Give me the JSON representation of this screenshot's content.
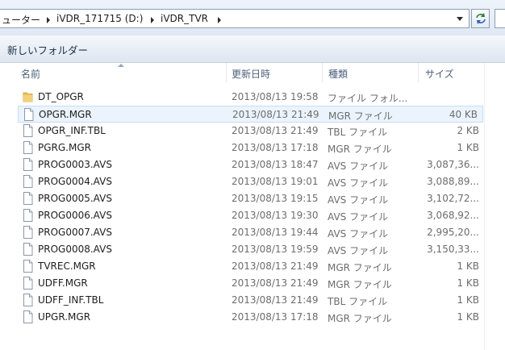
{
  "address_bar": {
    "crumbs": [
      {
        "label": "ューター"
      },
      {
        "label": "iVDR_171715 (D:)"
      },
      {
        "label": "iVDR_TVR"
      }
    ],
    "refresh_icon": "refresh-icon",
    "dropdown_icon": "chevron-down-icon"
  },
  "command_bar": {
    "new_folder_label": "新しいフォルダー"
  },
  "columns": {
    "name": "名前",
    "date": "更新日時",
    "type": "種類",
    "size": "サイズ"
  },
  "colors": {
    "selected_bg": "#ebf4fd",
    "selected_border": "#c7dcf5",
    "folder": "#e8c35a"
  },
  "files": [
    {
      "name": "DT_OPGR",
      "date": "2013/08/13 19:58",
      "type": "ファイル フォル...",
      "size": "",
      "icon": "folder-icon"
    },
    {
      "name": "OPGR.MGR",
      "date": "2013/08/13 21:49",
      "type": "MGR ファイル",
      "size": "40 KB",
      "icon": "file-icon",
      "selected": true
    },
    {
      "name": "OPGR_INF.TBL",
      "date": "2013/08/13 21:49",
      "type": "TBL ファイル",
      "size": "2 KB",
      "icon": "file-icon"
    },
    {
      "name": "PGRG.MGR",
      "date": "2013/08/13 17:18",
      "type": "MGR ファイル",
      "size": "1 KB",
      "icon": "file-icon"
    },
    {
      "name": "PROG0003.AVS",
      "date": "2013/08/13 18:47",
      "type": "AVS ファイル",
      "size": "3,087,36...",
      "icon": "file-icon"
    },
    {
      "name": "PROG0004.AVS",
      "date": "2013/08/13 19:01",
      "type": "AVS ファイル",
      "size": "3,088,89...",
      "icon": "file-icon"
    },
    {
      "name": "PROG0005.AVS",
      "date": "2013/08/13 19:15",
      "type": "AVS ファイル",
      "size": "3,102,72...",
      "icon": "file-icon"
    },
    {
      "name": "PROG0006.AVS",
      "date": "2013/08/13 19:30",
      "type": "AVS ファイル",
      "size": "3,068,92...",
      "icon": "file-icon"
    },
    {
      "name": "PROG0007.AVS",
      "date": "2013/08/13 19:44",
      "type": "AVS ファイル",
      "size": "2,995,20...",
      "icon": "file-icon"
    },
    {
      "name": "PROG0008.AVS",
      "date": "2013/08/13 19:59",
      "type": "AVS ファイル",
      "size": "3,150,33...",
      "icon": "file-icon"
    },
    {
      "name": "TVREC.MGR",
      "date": "2013/08/13 21:49",
      "type": "MGR ファイル",
      "size": "1 KB",
      "icon": "file-icon"
    },
    {
      "name": "UDFF.MGR",
      "date": "2013/08/13 21:49",
      "type": "MGR ファイル",
      "size": "1 KB",
      "icon": "file-icon"
    },
    {
      "name": "UDFF_INF.TBL",
      "date": "2013/08/13 21:49",
      "type": "TBL ファイル",
      "size": "1 KB",
      "icon": "file-icon"
    },
    {
      "name": "UPGR.MGR",
      "date": "2013/08/13 17:18",
      "type": "MGR ファイル",
      "size": "1 KB",
      "icon": "file-icon"
    }
  ]
}
